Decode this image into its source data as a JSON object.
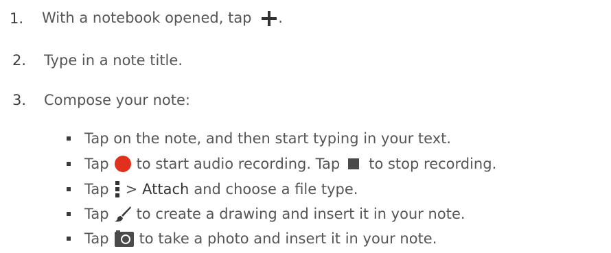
{
  "steps": [
    {
      "number": "1.",
      "text_before": "With a notebook opened, tap",
      "text_after": ".",
      "icon": "plus-icon"
    },
    {
      "number": "2.",
      "text": "Type in a note title."
    },
    {
      "number": "3.",
      "text": "Compose your note:"
    }
  ],
  "bullets": {
    "b1": {
      "text": "Tap on the note, and then start typing in your text."
    },
    "b2": {
      "tap": "Tap",
      "icon1": "record-icon",
      "middle": "to start audio recording. Tap",
      "icon2": "stop-icon",
      "end": "to stop recording."
    },
    "b3": {
      "tap": "Tap",
      "icon": "menu-icon",
      "gt": ">",
      "attach": "Attach",
      "end": "and choose a file type."
    },
    "b4": {
      "tap": "Tap",
      "icon": "brush-icon",
      "end": "to create a drawing and insert it in your note."
    },
    "b5": {
      "tap": "Tap",
      "icon": "camera-icon",
      "end": "to take a photo and insert it in your note."
    }
  },
  "colors": {
    "text": "#555555",
    "record": "#e0301e",
    "icon": "#4a4a4a"
  }
}
